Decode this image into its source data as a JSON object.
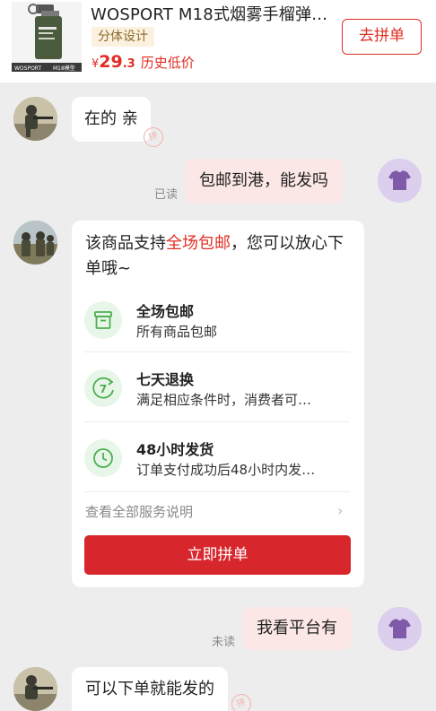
{
  "product": {
    "title": "WOSPORT M18式烟雾手榴弹…",
    "tag": "分体设计",
    "currency": "¥",
    "price_int": "29",
    "price_dec": ".3",
    "price_note": "历史低价",
    "buy_button": "去拼单",
    "thumb_label_left": "WOSPORT",
    "thumb_label_right": "M18模型"
  },
  "messages": [
    {
      "from": "seller",
      "text": "在的 亲"
    },
    {
      "from": "user",
      "text": "包邮到港，能发吗",
      "status": "已读"
    },
    {
      "from": "user",
      "text": "我看平台有",
      "status": "未读"
    },
    {
      "from": "seller",
      "text": "可以下单就能发的"
    }
  ],
  "stamp": "拼",
  "service_card": {
    "intro_prefix": "该商品支持",
    "intro_highlight": "全场包邮",
    "intro_suffix": "，您可以放心下单哦~",
    "items": [
      {
        "title": "全场包邮",
        "desc": "所有商品包邮",
        "icon": "box-icon"
      },
      {
        "title": "七天退换",
        "desc": "满足相应条件时，消费者可…",
        "icon": "seven-day-return-icon"
      },
      {
        "title": "48小时发货",
        "desc": "订单支付成功后48小时内发…",
        "icon": "clock-icon"
      }
    ],
    "more_label": "查看全部服务说明",
    "cta_label": "立即拼单"
  },
  "colors": {
    "accent": "#e02e24",
    "button_red": "#d8262d",
    "user_bubble": "#fbe7e5",
    "service_icon_bg": "#e7f6e8",
    "service_icon": "#4caf50",
    "background": "#ededed"
  }
}
